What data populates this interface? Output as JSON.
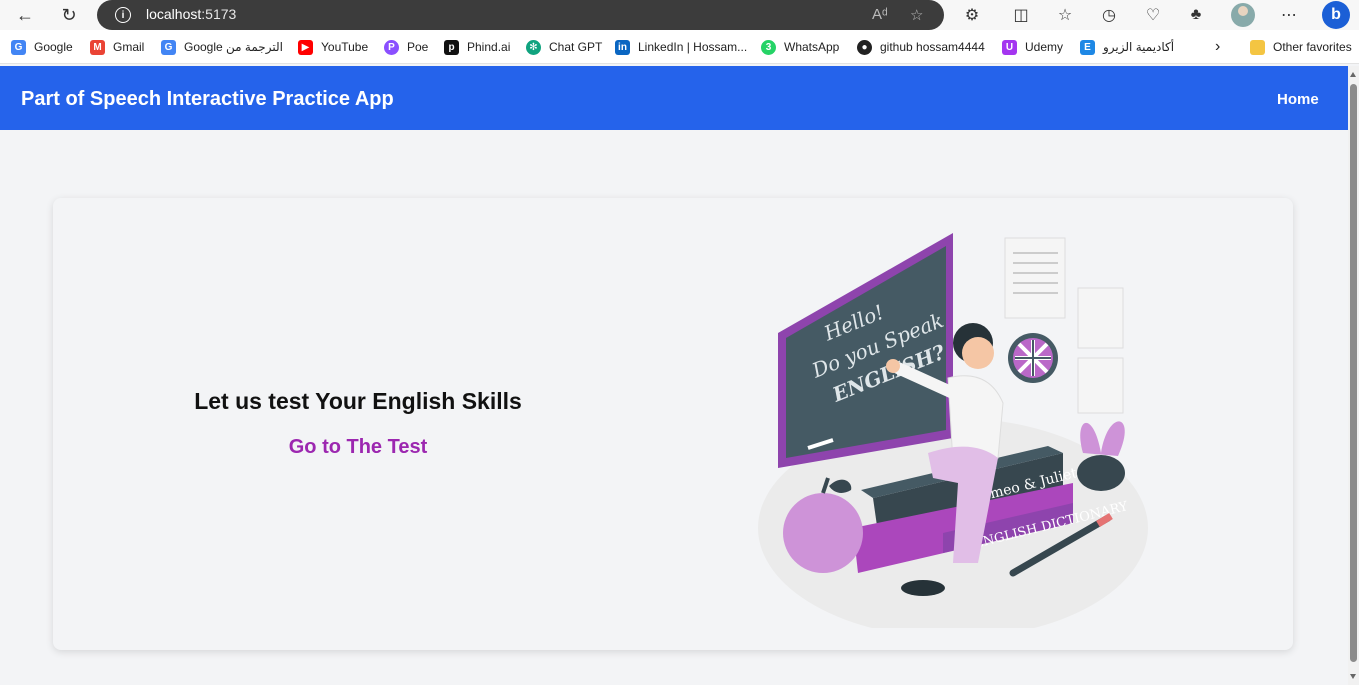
{
  "browser": {
    "url_host": "localhost",
    "url_port": ":5173"
  },
  "bookmarks": [
    {
      "label": "Google",
      "icon": "google-icon",
      "color": "#4285f4"
    },
    {
      "label": "Gmail",
      "icon": "gmail-icon",
      "color": "#ea4335"
    },
    {
      "label": "Google الترجمة من",
      "icon": "translate-icon",
      "color": "#4285f4"
    },
    {
      "label": "YouTube",
      "icon": "youtube-icon",
      "color": "#ff0000"
    },
    {
      "label": "Poe",
      "icon": "poe-icon",
      "color": "#8a4fff"
    },
    {
      "label": "Phind.ai",
      "icon": "phind-icon",
      "color": "#111111"
    },
    {
      "label": "Chat GPT",
      "icon": "chatgpt-icon",
      "color": "#10a37f"
    },
    {
      "label": "LinkedIn | Hossam...",
      "icon": "linkedin-icon",
      "color": "#0a66c2"
    },
    {
      "label": "WhatsApp",
      "icon": "whatsapp-icon",
      "color": "#25d366"
    },
    {
      "label": "github hossam4444",
      "icon": "github-icon",
      "color": "#222222"
    },
    {
      "label": "Udemy",
      "icon": "udemy-icon",
      "color": "#a435f0"
    },
    {
      "label": "أكاديمية الزيرو",
      "icon": "zero-academy-icon",
      "color": "#1e88e5"
    },
    {
      "label": "Other favorites",
      "icon": "folder-icon",
      "color": "#f4c542"
    }
  ],
  "app": {
    "title": "Part of Speech Interactive Practice App",
    "nav_home": "Home",
    "accent": "#2563eb"
  },
  "hero": {
    "headline": "Let us test Your English Skills",
    "cta": "Go to The Test",
    "cta_color": "#9c27b0"
  },
  "illustration": {
    "board_line1": "Hello!",
    "board_line2": "Do you Speak",
    "board_line3": "ENGLISH?",
    "book1": "Romeo & Juliet",
    "book2": "ENGLISH DICTIONARY"
  }
}
